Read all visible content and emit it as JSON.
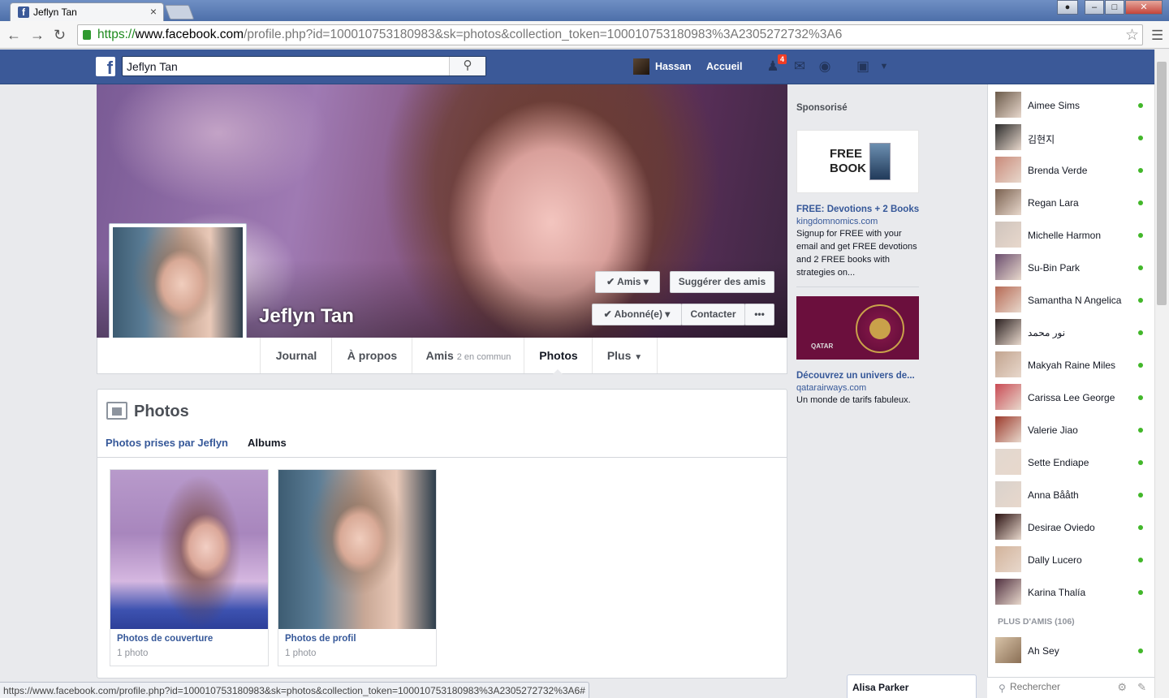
{
  "browser": {
    "tab_title": "Jeflyn Tan",
    "tab_close": "×",
    "url_scheme": "https://",
    "url_domain": "www.facebook.com",
    "url_rest": "/profile.php?id=100010753180983&sk=photos&collection_token=100010753180983%3A2305272732%3A6",
    "status_url": "https://www.facebook.com/profile.php?id=100010753180983&sk=photos&collection_token=100010753180983%3A2305272732%3A6#"
  },
  "header": {
    "search_value": "Jeflyn Tan",
    "user_name": "Hassan",
    "home_label": "Accueil",
    "friend_requests_count": "4"
  },
  "profile": {
    "name": "Jeflyn Tan",
    "friends_button": "Amis",
    "suggest_button": "Suggérer des amis",
    "follow_button": "Abonné(e)",
    "message_button": "Contacter",
    "more_button": "•••"
  },
  "timeline_nav": {
    "journal": "Journal",
    "about": "À propos",
    "friends": "Amis",
    "friends_sub": "2 en commun",
    "photos": "Photos",
    "more": "Plus"
  },
  "photos": {
    "title": "Photos",
    "tab_taken": "Photos prises par Jeflyn",
    "tab_albums": "Albums",
    "albums": [
      {
        "name": "Photos de couverture",
        "count": "1 photo"
      },
      {
        "name": "Photos de profil",
        "count": "1 photo"
      }
    ]
  },
  "ads": {
    "label": "Sponsorisé",
    "ad1": {
      "image_text": "FREE BOOK",
      "headline": "FREE: Devotions + 2 Books",
      "domain": "kingdomnomics.com",
      "text": "Signup for FREE with your email and get FREE devotions and 2 FREE books with strategies on..."
    },
    "ad2": {
      "image_text": "QATAR",
      "headline": "Découvrez un univers de...",
      "domain": "qatarairways.com",
      "text": "Un monde de tarifs fabuleux."
    }
  },
  "chat": {
    "friends": [
      {
        "name": "Aimee Sims"
      },
      {
        "name": "김현지"
      },
      {
        "name": "Brenda Verde"
      },
      {
        "name": "Regan Lara"
      },
      {
        "name": "Michelle Harmon"
      },
      {
        "name": "Su-Bin Park"
      },
      {
        "name": "Samantha N Angelica"
      },
      {
        "name": "نور محمد"
      },
      {
        "name": "Makyah Raine Miles"
      },
      {
        "name": "Carissa Lee George"
      },
      {
        "name": "Valerie Jiao"
      },
      {
        "name": "Sette Endiape"
      },
      {
        "name": "Anna Bååth"
      },
      {
        "name": "Desirae Oviedo"
      },
      {
        "name": "Dally Lucero"
      },
      {
        "name": "Karina Thalía"
      }
    ],
    "more_friends_label": "PLUS D'AMIS (106)",
    "extra_friend": "Ah Sey",
    "search_placeholder": "Rechercher",
    "open_chat_tab": "Alisa Parker"
  },
  "colors": {
    "fb_blue": "#3b5998",
    "link_blue": "#365899",
    "online_green": "#42b72a"
  }
}
